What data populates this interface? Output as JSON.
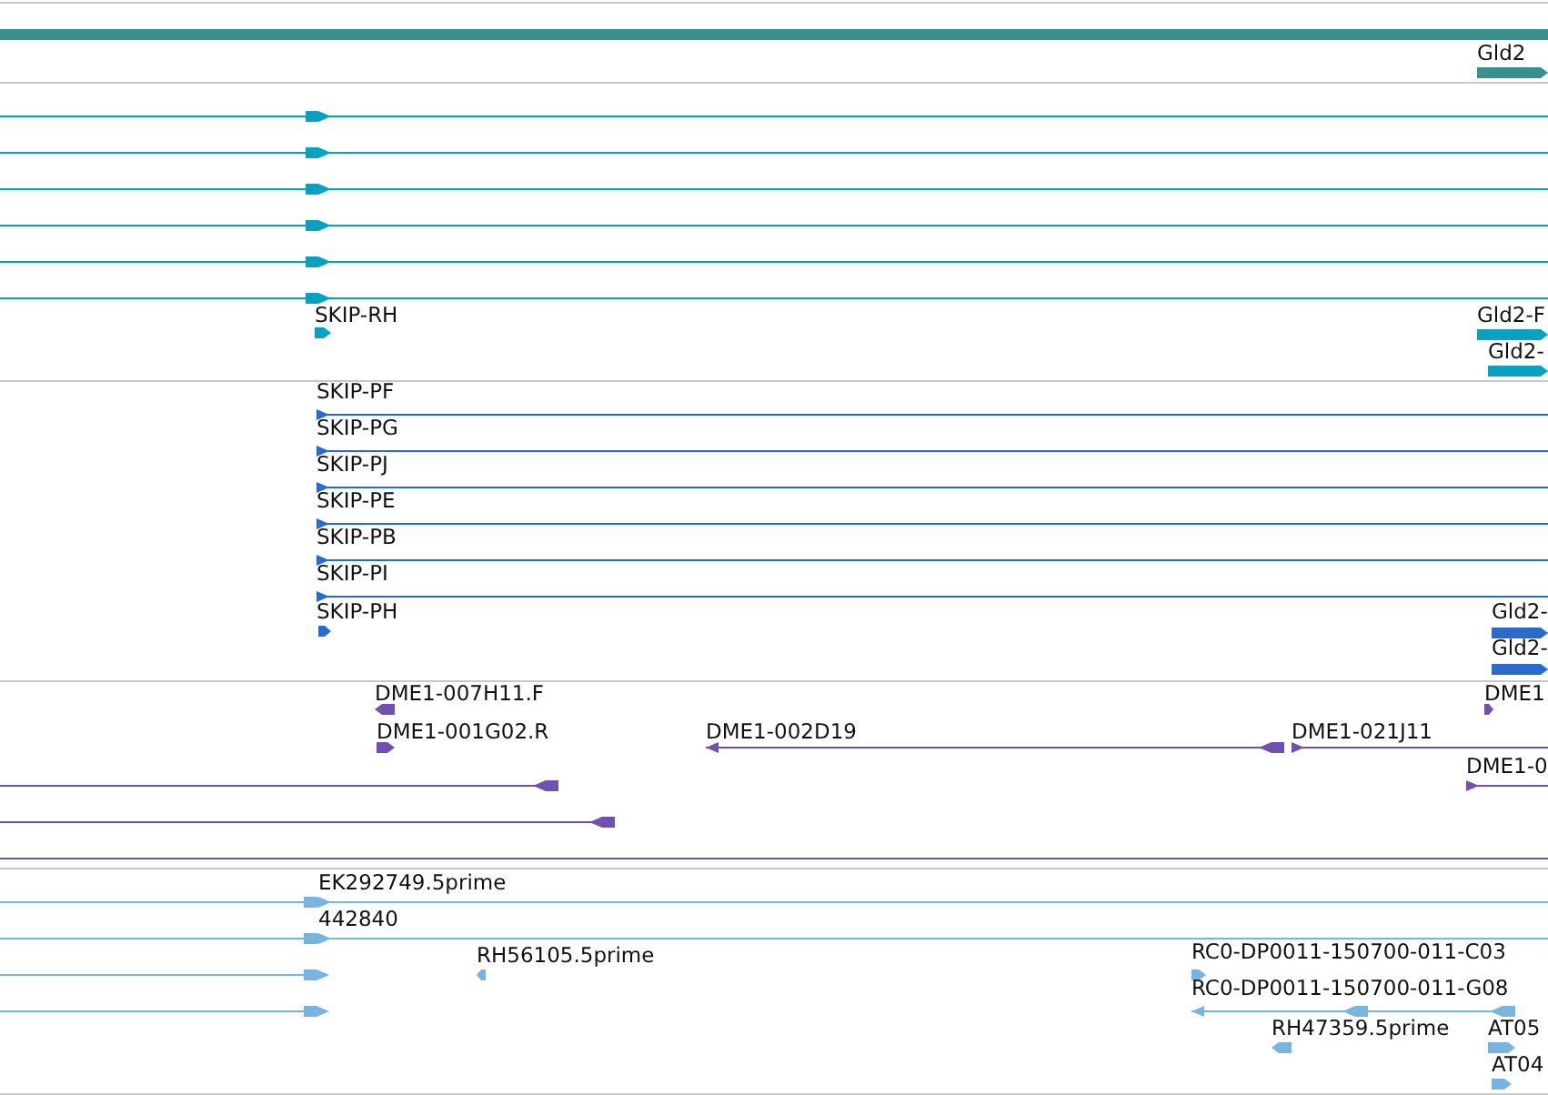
{
  "tracks": [
    {
      "color": "#3a8e8e",
      "features": [
        {
          "label": "Gld2",
          "reverse": false
        }
      ]
    },
    {
      "color": "#0aa0c0",
      "features": [
        {
          "label": "SKIP-RH",
          "reverse": false
        },
        {
          "label": "Gld2-F",
          "reverse": false
        },
        {
          "label": "Gld2-",
          "reverse": false
        }
      ]
    },
    {
      "color": "#2a6acc",
      "features": [
        {
          "label": "SKIP-PF",
          "reverse": false
        },
        {
          "label": "SKIP-PG",
          "reverse": false
        },
        {
          "label": "SKIP-PJ",
          "reverse": false
        },
        {
          "label": "SKIP-PE",
          "reverse": false
        },
        {
          "label": "SKIP-PB",
          "reverse": false
        },
        {
          "label": "SKIP-PI",
          "reverse": false
        },
        {
          "label": "SKIP-PH",
          "reverse": false
        },
        {
          "label": "Gld2-",
          "reverse": false
        },
        {
          "label": "Gld2-",
          "reverse": false
        }
      ]
    },
    {
      "color": "#7050b0",
      "features": [
        {
          "label": "DME1-007H11.F",
          "reverse": true
        },
        {
          "label": "DME1-001G02.R",
          "reverse": false
        },
        {
          "label": "DME1-002D19",
          "reverse": true
        },
        {
          "label": "DME1-021J11",
          "reverse": false
        },
        {
          "label": "DME1",
          "reverse": false
        },
        {
          "label": "DME1-0",
          "reverse": false
        }
      ]
    },
    {
      "color": "#78b4e0",
      "features": [
        {
          "label": "EK292749.5prime",
          "reverse": false
        },
        {
          "label": "442840",
          "reverse": false
        },
        {
          "label": "RH56105.5prime",
          "reverse": true
        },
        {
          "label": "RC0-DP0011-150700-011-C03",
          "reverse": false
        },
        {
          "label": "RC0-DP0011-150700-011-G08",
          "reverse": true
        },
        {
          "label": "RH47359.5prime",
          "reverse": true
        },
        {
          "label": "AT05",
          "reverse": false
        },
        {
          "label": "AT04",
          "reverse": false
        }
      ]
    }
  ]
}
